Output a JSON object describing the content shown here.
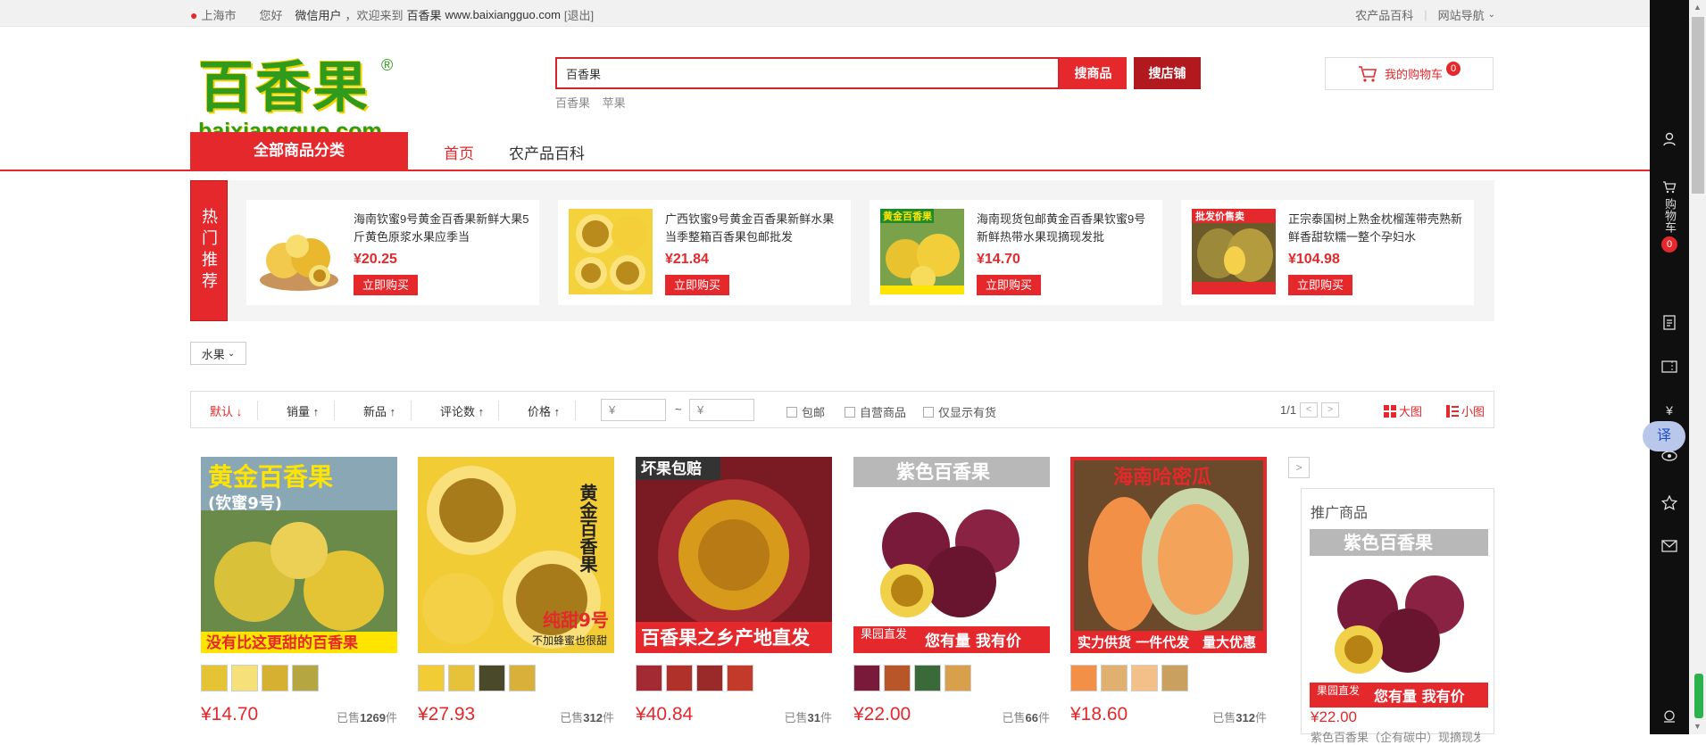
{
  "topbar": {
    "location": "上海市",
    "greeting": "您好",
    "user": "微信用户",
    "welcome": "，欢迎来到",
    "site_name": "百香果",
    "site_url": "www.baixiangguo.com",
    "logout": "[退出]",
    "right_link": "农产品百科",
    "site_nav": "网站导航"
  },
  "logo": {
    "cn": "百香果",
    "en": "baixiangguo.com",
    "reg": "®"
  },
  "search": {
    "value": "百香果",
    "btn_goods": "搜商品",
    "btn_shop": "搜店铺",
    "hotwords": [
      "百香果",
      "苹果"
    ]
  },
  "cart": {
    "label": "我的购物车",
    "count": "0"
  },
  "nav": {
    "all_categories": "全部商品分类",
    "home": "首页",
    "encyclopedia": "农产品百科"
  },
  "hot": {
    "label": "热门推荐",
    "buy_label": "立即购买",
    "items": [
      {
        "name": "海南钦蜜9号黄金百香果新鲜大果5斤黄色原浆水果应季当",
        "price": "¥20.25"
      },
      {
        "name": "广西钦蜜9号黄金百香果新鲜水果当季整箱百香果包邮批发",
        "price": "¥21.84"
      },
      {
        "name": "海南现货包邮黄金百香果钦蜜9号新鲜热带水果现摘现发批",
        "price": "¥14.70"
      },
      {
        "name": "正宗泰国树上熟金枕榴莲带壳熟新鲜香甜软糯一整个孕妇水",
        "price": "¥104.98"
      }
    ],
    "img_texts": [
      "",
      "",
      "黄金百香果",
      "批发价售卖"
    ]
  },
  "filter": {
    "category": "水果"
  },
  "sortbar": {
    "sorts": [
      "默认",
      "销量",
      "新品",
      "评论数",
      "价格"
    ],
    "price_from": "¥",
    "price_tilde": "~",
    "price_to": "¥",
    "checks": [
      "包邮",
      "自营商品",
      "仅显示有货"
    ],
    "page": "1/1",
    "view_big": "大图",
    "view_small": "小图"
  },
  "products": [
    {
      "price": "¥14.70",
      "sold_prefix": "已售",
      "sold": "1269",
      "sold_suffix": "件",
      "banner_top": "黄金百香果",
      "banner_sub": "(钦蜜9号)",
      "banner_bottom": "没有比这更甜的百香果"
    },
    {
      "price": "¥27.93",
      "sold_prefix": "已售",
      "sold": "312",
      "sold_suffix": "件",
      "banner_top": "黄金百香果",
      "banner_sub": "纯甜9号",
      "banner_bottom": "不加蜂蜜也很甜"
    },
    {
      "price": "¥40.84",
      "sold_prefix": "已售",
      "sold": "31",
      "sold_suffix": "件",
      "banner_top": "坏果包赔",
      "banner_sub": "",
      "banner_bottom": "百香果之乡产地直发"
    },
    {
      "price": "¥22.00",
      "sold_prefix": "已售",
      "sold": "66",
      "sold_suffix": "件",
      "banner_top": "紫色百香果",
      "banner_sub": "果园直发",
      "banner_bottom": "您有量 我有价"
    },
    {
      "price": "¥18.60",
      "sold_prefix": "已售",
      "sold": "312",
      "sold_suffix": "件",
      "banner_top": "海南哈密瓜",
      "banner_sub": "实力供货 一件代发",
      "banner_bottom": "量大优惠"
    }
  ],
  "promo": {
    "title": "推广商品",
    "banner_top": "紫色百香果",
    "banner_sub": "果园直发",
    "banner_bottom": "您有量 我有价",
    "price": "¥22.00",
    "desc": "紫色百香果（企有碳中）现摘现发"
  },
  "sidebar": {
    "cart_label": "购物车",
    "cart_count": "0",
    "translate": "译"
  }
}
